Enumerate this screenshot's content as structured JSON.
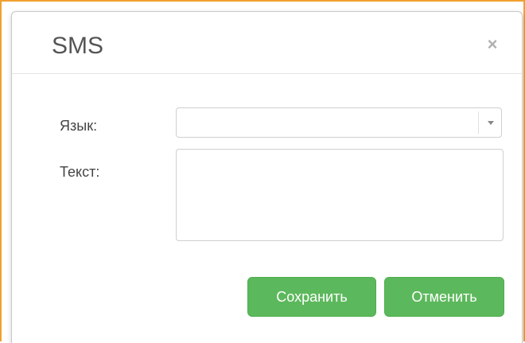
{
  "dialog": {
    "title": "SMS",
    "close_icon": "close-icon",
    "close_glyph": "×"
  },
  "form": {
    "language": {
      "label": "Язык:",
      "value": ""
    },
    "text": {
      "label": "Текст:",
      "value": ""
    }
  },
  "actions": {
    "save_label": "Сохранить",
    "cancel_label": "Отменить"
  },
  "colors": {
    "accent_border": "#f0a030",
    "button_green": "#5cb85c"
  }
}
